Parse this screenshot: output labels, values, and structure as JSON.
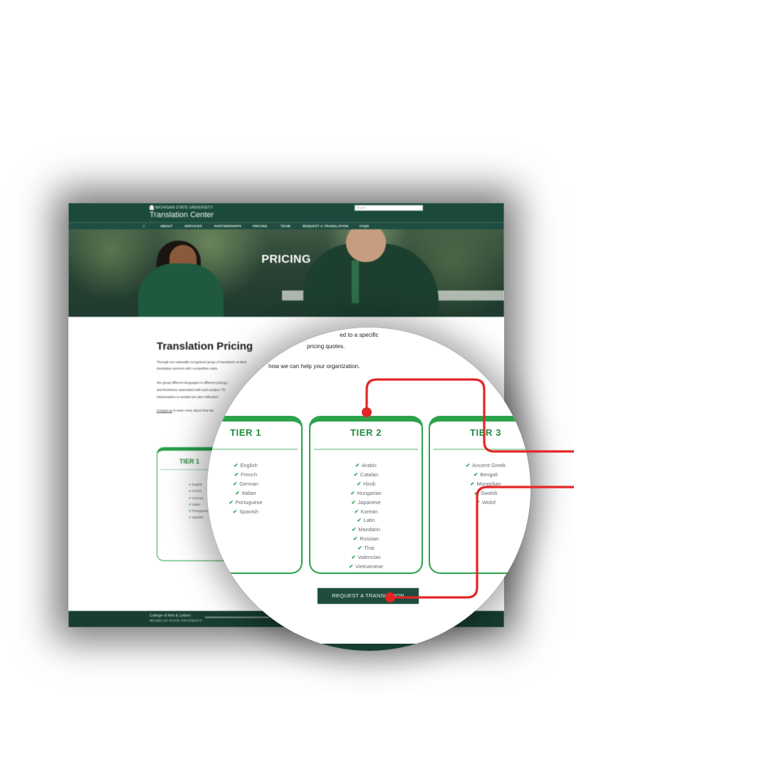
{
  "site": {
    "university": "MICHIGAN STATE UNIVERSITY",
    "title": "Translation Center",
    "search_placeholder": "Search",
    "nav": [
      "ABOUT",
      "SERVICES",
      "PARTNERSHIPS",
      "PRICING",
      "TEAM",
      "REQUEST A TRANSLATION",
      "FAQS"
    ],
    "hero_title": "PRICING"
  },
  "content": {
    "heading": "Translation Pricing",
    "p1_line1": "Through our nationally recognized group of translators at Mich",
    "p1_line2": "translation services with competitive rates.",
    "p2_line1": "We group different languages in different pricing t",
    "p2_line2": "and timeframe associated with each project. Th",
    "p2_line3": "interpretation is needed are also reflected i",
    "contact_link": "Contact us",
    "contact_rest": "to learn more about how we"
  },
  "magnifier": {
    "text_line1": "ed to a specific",
    "text_line2": "pricing quotes.",
    "text_line3": "how we can help your organization."
  },
  "tiers": [
    {
      "title": "TIER 1",
      "languages": [
        "English",
        "French",
        "German",
        "Italian",
        "Portuguese",
        "Spanish"
      ]
    },
    {
      "title": "TIER 2",
      "languages": [
        "Arabic",
        "Catalan",
        "Hindi",
        "Hungarian",
        "Japanese",
        "Korean",
        "Latin",
        "Mandarin",
        "Russian",
        "Thai",
        "Valencian",
        "Vietnamese"
      ]
    },
    {
      "title": "TIER 3",
      "languages": [
        "Ancient Greek",
        "Bengali",
        "Mongolian",
        "Swahili",
        "Wolof"
      ]
    }
  ],
  "cta": {
    "label": "REQUEST A TRANSLATION"
  },
  "footer": {
    "college": "College of Arts & Letters",
    "university": "MICHIGAN STATE UNIVERSITY"
  },
  "colors": {
    "msu_green": "#1b4a3c",
    "tier_green": "#2ba34a",
    "annotation_red": "#e32626"
  }
}
